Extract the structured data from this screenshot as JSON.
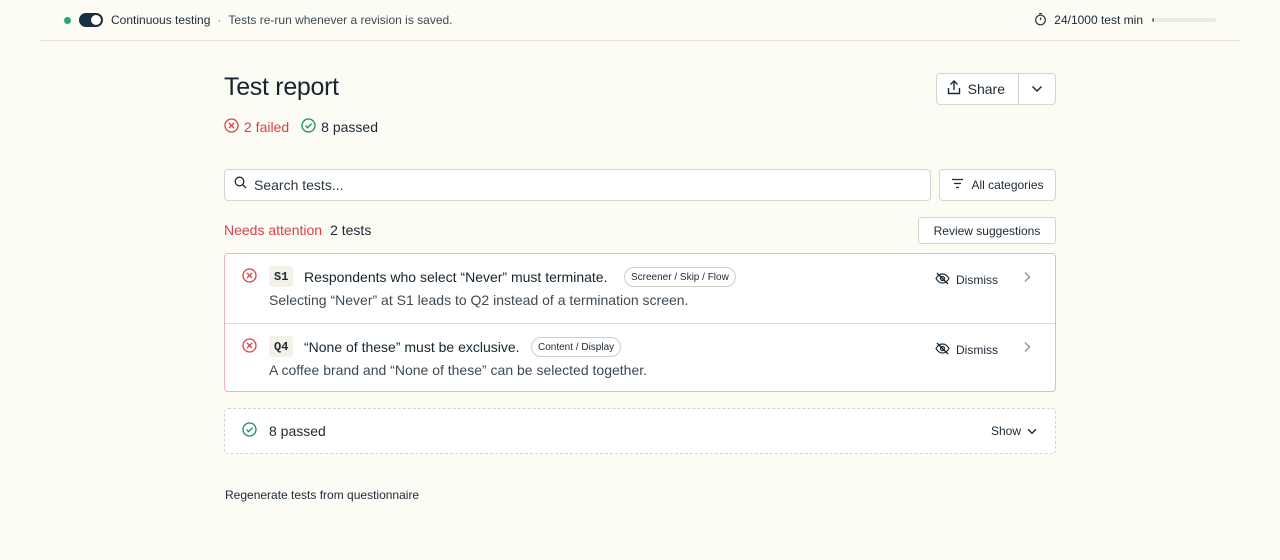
{
  "topbar": {
    "title": "Continuous testing",
    "separator": "·",
    "description": "Tests re-run whenever a revision is saved.",
    "usage_text": "24/1000 test min",
    "usage_fraction": 0.024,
    "toggle_on": true,
    "status_color": "#1faa6e"
  },
  "header": {
    "title": "Test report",
    "share_label": "Share"
  },
  "summary": {
    "failed_label": "2 failed",
    "passed_label": "8 passed"
  },
  "search": {
    "placeholder": "Search tests...",
    "value": ""
  },
  "filter": {
    "label": "All categories"
  },
  "attention": {
    "label": "Needs attention",
    "count": "2 tests",
    "review_label": "Review suggestions",
    "color": "#d9424a"
  },
  "failed_tests": [
    {
      "id": "S1",
      "title": "Respondents who select “Never” must terminate.",
      "tag": "Screener / Skip / Flow",
      "description": "Selecting “Never” at S1 leads to Q2 instead of a termination screen.",
      "dismiss_label": "Dismiss"
    },
    {
      "id": "Q4",
      "title": "“None of these” must be exclusive.",
      "tag": "Content / Display",
      "description": "A coffee brand and “None of these” can be selected together.",
      "dismiss_label": "Dismiss"
    }
  ],
  "passed": {
    "label": "8 passed",
    "show_label": "Show"
  },
  "footer": {
    "regenerate_label": "Regenerate tests from questionnaire"
  },
  "icons": {
    "status": "status-dot-icon",
    "timer": "stopwatch-icon",
    "share": "upload-icon",
    "caret": "chevron-down-icon",
    "search": "search-icon",
    "filter": "filter-icon",
    "fail": "x-circle-icon",
    "pass": "check-circle-icon",
    "dismiss": "eye-off-icon",
    "open": "chevron-right-icon"
  }
}
